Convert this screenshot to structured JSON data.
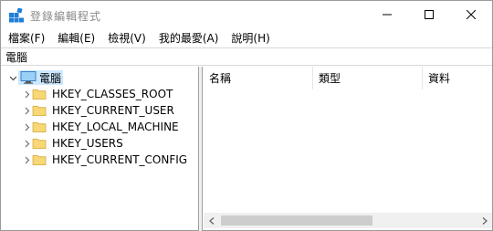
{
  "window": {
    "title": "登錄編輯程式",
    "icon": "registry-editor-icon",
    "controls": [
      "minimize-icon",
      "maximize-icon",
      "close-icon"
    ]
  },
  "menu": {
    "items": [
      {
        "label": "檔案(F)"
      },
      {
        "label": "編輯(E)"
      },
      {
        "label": "檢視(V)"
      },
      {
        "label": "我的最愛(A)"
      },
      {
        "label": "說明(H)"
      }
    ]
  },
  "address": {
    "path": "電腦"
  },
  "tree": {
    "root": {
      "label": "電腦",
      "icon": "computer-icon",
      "expanded": true
    },
    "children": [
      {
        "label": "HKEY_CLASSES_ROOT",
        "icon": "folder-icon"
      },
      {
        "label": "HKEY_CURRENT_USER",
        "icon": "folder-icon"
      },
      {
        "label": "HKEY_LOCAL_MACHINE",
        "icon": "folder-icon"
      },
      {
        "label": "HKEY_USERS",
        "icon": "folder-icon"
      },
      {
        "label": "HKEY_CURRENT_CONFIG",
        "icon": "folder-icon"
      }
    ]
  },
  "list": {
    "columns": [
      {
        "label": "名稱"
      },
      {
        "label": "類型"
      },
      {
        "label": "資料"
      }
    ]
  },
  "colors": {
    "selection": "#cce8ff",
    "folder": "#f8d775",
    "icon_blue": "#1f7ed8"
  }
}
